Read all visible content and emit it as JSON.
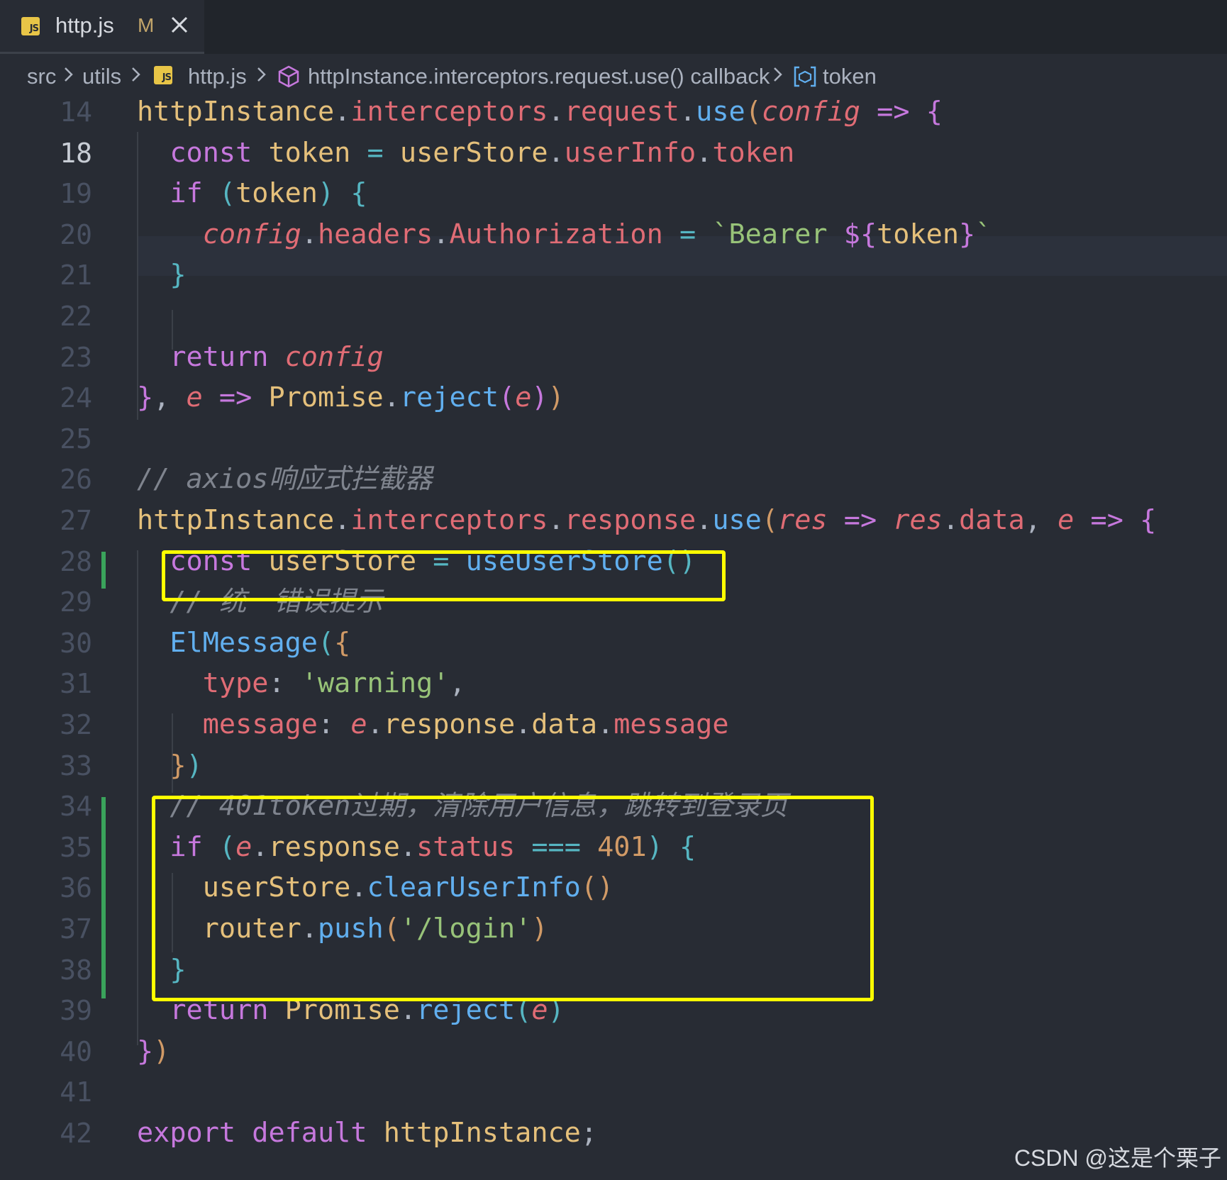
{
  "tab": {
    "icon": "js-file-icon",
    "filename": "http.js",
    "status": "M",
    "close_icon": "close-icon"
  },
  "breadcrumb": {
    "items": [
      "src",
      "utils",
      "http.js",
      "httpInstance.interceptors.request.use() callback",
      "token"
    ],
    "icons": [
      "chevron-right-icon",
      "js-file-icon",
      "method-cube-icon",
      "variable-icon"
    ]
  },
  "editor": {
    "active_line": 18,
    "lines": [
      {
        "n": "14",
        "segments": [
          [
            "var",
            "httpInstance"
          ],
          [
            "",
            "."
          ],
          [
            "prop",
            "interceptors"
          ],
          [
            "",
            "."
          ],
          [
            "prop",
            "request"
          ],
          [
            "",
            "."
          ],
          [
            "fn",
            "use"
          ],
          [
            "b1",
            "("
          ],
          [
            "param",
            "config"
          ],
          [
            "",
            " "
          ],
          [
            "kw",
            "=>"
          ],
          [
            "",
            " "
          ],
          [
            "b2",
            "{"
          ]
        ]
      },
      {
        "n": "18",
        "segments": [
          [
            "",
            "  "
          ],
          [
            "kw",
            "const"
          ],
          [
            "",
            " "
          ],
          [
            "var",
            "token"
          ],
          [
            "",
            " "
          ],
          [
            "op",
            "="
          ],
          [
            "",
            " "
          ],
          [
            "var",
            "userStore"
          ],
          [
            "",
            "."
          ],
          [
            "prop",
            "userInfo"
          ],
          [
            "",
            "."
          ],
          [
            "prop",
            "token"
          ]
        ]
      },
      {
        "n": "19",
        "segments": [
          [
            "",
            "  "
          ],
          [
            "kw",
            "if"
          ],
          [
            "",
            " "
          ],
          [
            "b3",
            "("
          ],
          [
            "var",
            "token"
          ],
          [
            "b3",
            ")"
          ],
          [
            "",
            " "
          ],
          [
            "b3",
            "{"
          ]
        ]
      },
      {
        "n": "20",
        "segments": [
          [
            "",
            "    "
          ],
          [
            "param",
            "config"
          ],
          [
            "",
            "."
          ],
          [
            "prop",
            "headers"
          ],
          [
            "",
            "."
          ],
          [
            "prop",
            "Authorization"
          ],
          [
            "",
            " "
          ],
          [
            "op",
            "="
          ],
          [
            "",
            " "
          ],
          [
            "str",
            "`Bearer "
          ],
          [
            "kw",
            "${"
          ],
          [
            "var",
            "token"
          ],
          [
            "kw",
            "}"
          ],
          [
            "str",
            "`"
          ]
        ]
      },
      {
        "n": "21",
        "segments": [
          [
            "",
            "  "
          ],
          [
            "b3",
            "}"
          ]
        ]
      },
      {
        "n": "22",
        "segments": []
      },
      {
        "n": "23",
        "segments": [
          [
            "",
            "  "
          ],
          [
            "kw",
            "return"
          ],
          [
            "",
            " "
          ],
          [
            "param",
            "config"
          ]
        ]
      },
      {
        "n": "24",
        "segments": [
          [
            "b2",
            "}"
          ],
          [
            "",
            ", "
          ],
          [
            "param",
            "e"
          ],
          [
            "",
            " "
          ],
          [
            "kw",
            "=>"
          ],
          [
            "",
            " "
          ],
          [
            "var",
            "Promise"
          ],
          [
            "",
            "."
          ],
          [
            "fn",
            "reject"
          ],
          [
            "b2",
            "("
          ],
          [
            "param",
            "e"
          ],
          [
            "b2",
            ")"
          ],
          [
            "b1",
            ")"
          ]
        ]
      },
      {
        "n": "25",
        "segments": []
      },
      {
        "n": "26",
        "segments": [
          [
            "cmt",
            "// axios"
          ],
          [
            "cmt cjk",
            "响应式拦截器"
          ]
        ]
      },
      {
        "n": "27",
        "segments": [
          [
            "var",
            "httpInstance"
          ],
          [
            "",
            "."
          ],
          [
            "prop",
            "interceptors"
          ],
          [
            "",
            "."
          ],
          [
            "prop",
            "response"
          ],
          [
            "",
            "."
          ],
          [
            "fn",
            "use"
          ],
          [
            "b1",
            "("
          ],
          [
            "param",
            "res"
          ],
          [
            "",
            " "
          ],
          [
            "kw",
            "=>"
          ],
          [
            "",
            " "
          ],
          [
            "param",
            "res"
          ],
          [
            "",
            "."
          ],
          [
            "prop",
            "data"
          ],
          [
            "",
            ", "
          ],
          [
            "param",
            "e"
          ],
          [
            "",
            " "
          ],
          [
            "kw",
            "=>"
          ],
          [
            "",
            " "
          ],
          [
            "b2",
            "{"
          ]
        ]
      },
      {
        "n": "28",
        "segments": [
          [
            "",
            "  "
          ],
          [
            "kw",
            "const"
          ],
          [
            "",
            " "
          ],
          [
            "var",
            "userStore"
          ],
          [
            "",
            " "
          ],
          [
            "op",
            "="
          ],
          [
            "",
            " "
          ],
          [
            "fn",
            "useUserStore"
          ],
          [
            "b3",
            "()"
          ]
        ]
      },
      {
        "n": "29",
        "segments": [
          [
            "",
            "  "
          ],
          [
            "cmt",
            "// "
          ],
          [
            "cmt cjk",
            "统一错误提示"
          ]
        ]
      },
      {
        "n": "30",
        "segments": [
          [
            "",
            "  "
          ],
          [
            "fn",
            "ElMessage"
          ],
          [
            "b3",
            "("
          ],
          [
            "b1",
            "{"
          ]
        ]
      },
      {
        "n": "31",
        "segments": [
          [
            "",
            "    "
          ],
          [
            "prop",
            "type"
          ],
          [
            "",
            ": "
          ],
          [
            "str",
            "'warning'"
          ],
          [
            "",
            ","
          ]
        ]
      },
      {
        "n": "32",
        "segments": [
          [
            "",
            "    "
          ],
          [
            "prop",
            "message"
          ],
          [
            "",
            ": "
          ],
          [
            "param",
            "e"
          ],
          [
            "",
            "."
          ],
          [
            "var",
            "response"
          ],
          [
            "",
            "."
          ],
          [
            "var",
            "data"
          ],
          [
            "",
            "."
          ],
          [
            "prop",
            "message"
          ]
        ]
      },
      {
        "n": "33",
        "segments": [
          [
            "",
            "  "
          ],
          [
            "b1",
            "}"
          ],
          [
            "b3",
            ")"
          ]
        ]
      },
      {
        "n": "34",
        "segments": [
          [
            "",
            "  "
          ],
          [
            "cmt",
            "// 401token"
          ],
          [
            "cmt cjk",
            "过期，清除用户信息，跳转到登录页"
          ]
        ]
      },
      {
        "n": "35",
        "segments": [
          [
            "",
            "  "
          ],
          [
            "kw",
            "if"
          ],
          [
            "",
            " "
          ],
          [
            "b3",
            "("
          ],
          [
            "param",
            "e"
          ],
          [
            "",
            "."
          ],
          [
            "var",
            "response"
          ],
          [
            "",
            "."
          ],
          [
            "prop",
            "status"
          ],
          [
            "",
            " "
          ],
          [
            "op",
            "==="
          ],
          [
            "",
            " "
          ],
          [
            "num",
            "401"
          ],
          [
            "b3",
            ")"
          ],
          [
            "",
            " "
          ],
          [
            "b3",
            "{"
          ]
        ]
      },
      {
        "n": "36",
        "segments": [
          [
            "",
            "    "
          ],
          [
            "var",
            "userStore"
          ],
          [
            "",
            "."
          ],
          [
            "fn",
            "clearUserInfo"
          ],
          [
            "b1",
            "()"
          ]
        ]
      },
      {
        "n": "37",
        "segments": [
          [
            "",
            "    "
          ],
          [
            "var",
            "router"
          ],
          [
            "",
            "."
          ],
          [
            "fn",
            "push"
          ],
          [
            "b1",
            "("
          ],
          [
            "str",
            "'/login'"
          ],
          [
            "b1",
            ")"
          ]
        ]
      },
      {
        "n": "38",
        "segments": [
          [
            "",
            "  "
          ],
          [
            "b3",
            "}"
          ]
        ]
      },
      {
        "n": "39",
        "segments": [
          [
            "",
            "  "
          ],
          [
            "kw",
            "return"
          ],
          [
            "",
            " "
          ],
          [
            "var",
            "Promise"
          ],
          [
            "",
            "."
          ],
          [
            "fn",
            "reject"
          ],
          [
            "b3",
            "("
          ],
          [
            "param",
            "e"
          ],
          [
            "b3",
            ")"
          ]
        ]
      },
      {
        "n": "40",
        "segments": [
          [
            "b2",
            "}"
          ],
          [
            "b1",
            ")"
          ]
        ]
      },
      {
        "n": "41",
        "segments": []
      },
      {
        "n": "42",
        "segments": [
          [
            "kw",
            "export"
          ],
          [
            "",
            " "
          ],
          [
            "kw",
            "default"
          ],
          [
            "",
            " "
          ],
          [
            "var",
            "httpInstance"
          ],
          [
            "",
            ";"
          ]
        ]
      }
    ]
  },
  "watermark": "CSDN @这是个栗子"
}
